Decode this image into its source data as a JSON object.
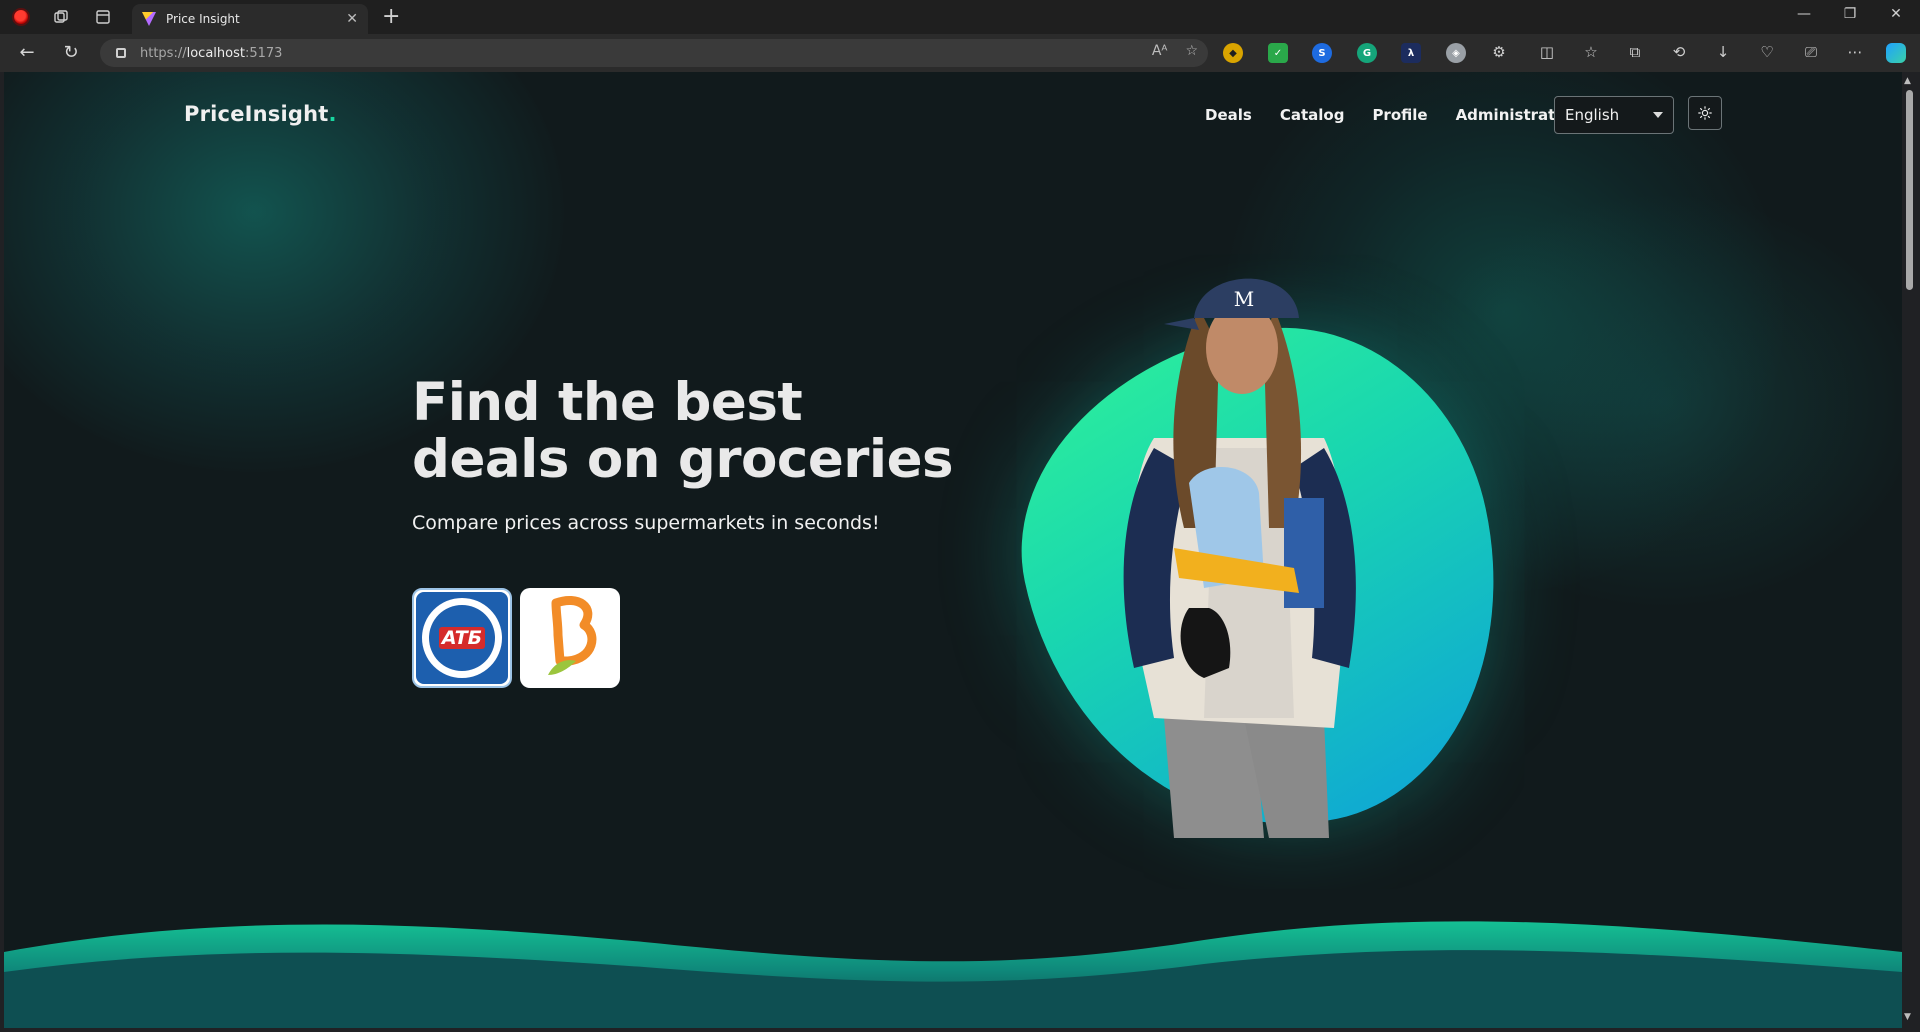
{
  "browser": {
    "tab_title": "Price Insight",
    "tab_close": "✕",
    "new_tab": "+",
    "url_protocol": "https://",
    "url_host": "localhost",
    "url_port": ":5173",
    "read_aloud_label": "Aᴬ",
    "window_controls": {
      "minimize": "—",
      "restore": "❐",
      "close": "✕"
    }
  },
  "site": {
    "logo_text": "PriceInsight",
    "logo_dot": ".",
    "nav": {
      "deals": "Deals",
      "catalog": "Catalog",
      "profile": "Profile",
      "administration": "Administration"
    },
    "language": {
      "selected": "English"
    },
    "theme_icon": "sun-icon"
  },
  "hero": {
    "title_line1": "Find the best",
    "title_line2": "deals on groceries",
    "subtitle": "Compare prices across supermarkets in seconds!"
  },
  "stores": [
    {
      "name": "ATB",
      "logo_text": "ATБ"
    },
    {
      "name": "Silpo",
      "logo_text": ""
    }
  ],
  "colors": {
    "accent": "#18d6a0",
    "background": "#111a1c",
    "blob_top": "#2ef09a",
    "blob_bottom": "#0ea2d8",
    "atb_blue": "#1d5fae",
    "atb_red": "#d52b2b",
    "silpo_orange": "#f28c28"
  }
}
